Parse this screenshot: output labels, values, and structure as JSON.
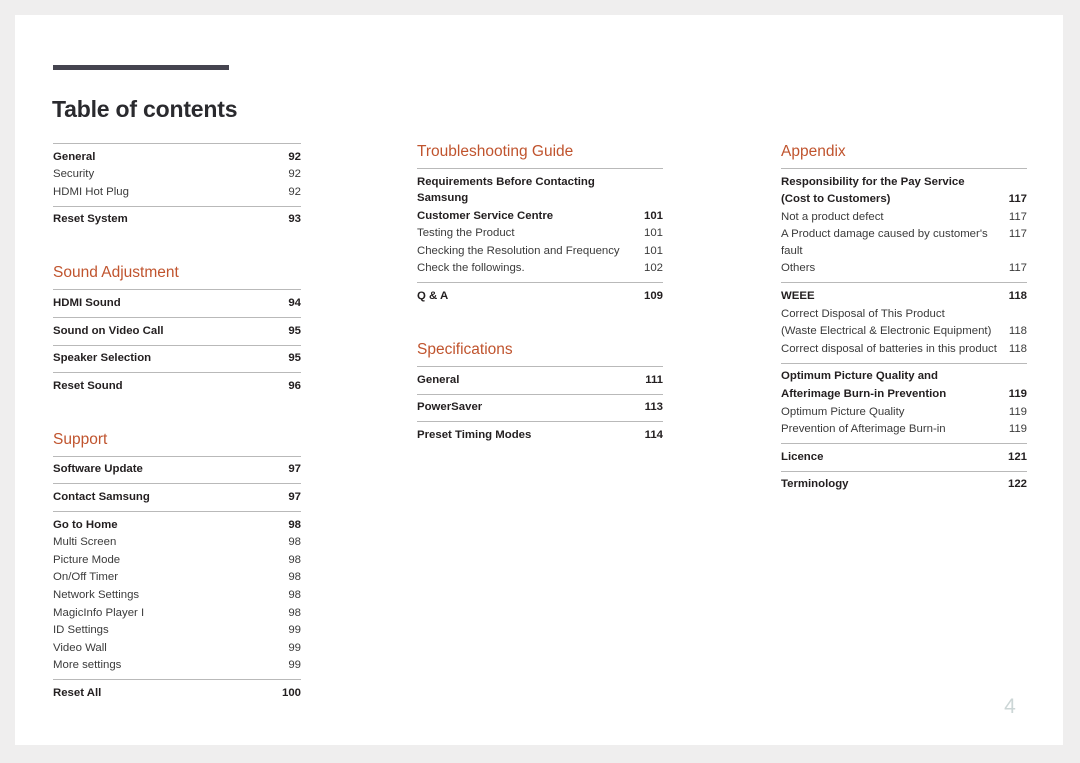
{
  "document": {
    "title": "Table of contents",
    "folio": "4",
    "accent_color": "#c0542e",
    "rule_color": "#45444f"
  },
  "columns": [
    {
      "name": "column-left",
      "sections": [
        {
          "heading": null,
          "groups": [
            {
              "entries": [
                {
                  "label": "General",
                  "page": "92",
                  "level": "main"
                },
                {
                  "label": "Security",
                  "page": "92",
                  "level": "sub"
                },
                {
                  "label": "HDMI Hot Plug",
                  "page": "92",
                  "level": "sub"
                }
              ]
            },
            {
              "entries": [
                {
                  "label": "Reset System",
                  "page": "93",
                  "level": "main"
                }
              ]
            }
          ]
        },
        {
          "heading": "Sound Adjustment",
          "groups": [
            {
              "entries": [
                {
                  "label": "HDMI Sound",
                  "page": "94",
                  "level": "main"
                }
              ]
            },
            {
              "entries": [
                {
                  "label": "Sound on Video Call",
                  "page": "95",
                  "level": "main"
                }
              ]
            },
            {
              "entries": [
                {
                  "label": "Speaker Selection",
                  "page": "95",
                  "level": "main"
                }
              ]
            },
            {
              "entries": [
                {
                  "label": "Reset Sound",
                  "page": "96",
                  "level": "main"
                }
              ]
            }
          ]
        },
        {
          "heading": "Support",
          "groups": [
            {
              "entries": [
                {
                  "label": "Software Update",
                  "page": "97",
                  "level": "main"
                }
              ]
            },
            {
              "entries": [
                {
                  "label": "Contact Samsung",
                  "page": "97",
                  "level": "main"
                }
              ]
            },
            {
              "entries": [
                {
                  "label": "Go to Home",
                  "page": "98",
                  "level": "main"
                },
                {
                  "label": "Multi Screen",
                  "page": "98",
                  "level": "sub"
                },
                {
                  "label": "Picture Mode",
                  "page": "98",
                  "level": "sub"
                },
                {
                  "label": "On/Off Timer",
                  "page": "98",
                  "level": "sub"
                },
                {
                  "label": "Network Settings",
                  "page": "98",
                  "level": "sub"
                },
                {
                  "label": "MagicInfo Player I",
                  "page": "98",
                  "level": "sub"
                },
                {
                  "label": "ID Settings",
                  "page": "99",
                  "level": "sub"
                },
                {
                  "label": "Video Wall",
                  "page": "99",
                  "level": "sub"
                },
                {
                  "label": "More settings",
                  "page": "99",
                  "level": "sub"
                }
              ]
            },
            {
              "entries": [
                {
                  "label": "Reset All",
                  "page": "100",
                  "level": "main"
                }
              ]
            }
          ]
        }
      ]
    },
    {
      "name": "column-middle",
      "sections": [
        {
          "heading": "Troubleshooting Guide",
          "groups": [
            {
              "entries": [
                {
                  "label": "Requirements Before Contacting Samsung",
                  "page": "",
                  "level": "main"
                },
                {
                  "label": "Customer Service Centre",
                  "page": "101",
                  "level": "main"
                },
                {
                  "label": "Testing the Product",
                  "page": "101",
                  "level": "sub"
                },
                {
                  "label": "Checking the Resolution and Frequency",
                  "page": "101",
                  "level": "sub"
                },
                {
                  "label": "Check the followings.",
                  "page": "102",
                  "level": "sub"
                }
              ]
            },
            {
              "entries": [
                {
                  "label": "Q & A",
                  "page": "109",
                  "level": "main"
                }
              ]
            }
          ]
        },
        {
          "heading": "Specifications",
          "groups": [
            {
              "entries": [
                {
                  "label": "General",
                  "page": "111",
                  "level": "main"
                }
              ]
            },
            {
              "entries": [
                {
                  "label": "PowerSaver",
                  "page": "113",
                  "level": "main"
                }
              ]
            },
            {
              "entries": [
                {
                  "label": "Preset Timing Modes",
                  "page": "114",
                  "level": "main"
                }
              ]
            }
          ]
        }
      ]
    },
    {
      "name": "column-right",
      "sections": [
        {
          "heading": "Appendix",
          "groups": [
            {
              "entries": [
                {
                  "label": "Responsibility for the Pay Service",
                  "page": "",
                  "level": "main"
                },
                {
                  "label": "(Cost to Customers)",
                  "page": "117",
                  "level": "main"
                },
                {
                  "label": "Not a product defect",
                  "page": "117",
                  "level": "sub"
                },
                {
                  "label": "A Product damage caused by customer's fault",
                  "page": "117",
                  "level": "sub"
                },
                {
                  "label": "Others",
                  "page": "117",
                  "level": "sub"
                }
              ]
            },
            {
              "entries": [
                {
                  "label": "WEEE",
                  "page": "118",
                  "level": "main"
                },
                {
                  "label": "Correct Disposal of This Product",
                  "page": "",
                  "level": "sub"
                },
                {
                  "label": "(Waste Electrical & Electronic Equipment)",
                  "page": "118",
                  "level": "sub"
                },
                {
                  "label": "Correct disposal of batteries in this product",
                  "page": "118",
                  "level": "sub"
                }
              ]
            },
            {
              "entries": [
                {
                  "label": "Optimum Picture Quality and",
                  "page": "",
                  "level": "main"
                },
                {
                  "label": "Afterimage Burn-in Prevention",
                  "page": "119",
                  "level": "main"
                },
                {
                  "label": "Optimum Picture Quality",
                  "page": "119",
                  "level": "sub"
                },
                {
                  "label": "Prevention of Afterimage Burn-in",
                  "page": "119",
                  "level": "sub"
                }
              ]
            },
            {
              "entries": [
                {
                  "label": "Licence",
                  "page": "121",
                  "level": "main"
                }
              ]
            },
            {
              "entries": [
                {
                  "label": "Terminology",
                  "page": "122",
                  "level": "main"
                }
              ]
            }
          ]
        }
      ]
    }
  ]
}
